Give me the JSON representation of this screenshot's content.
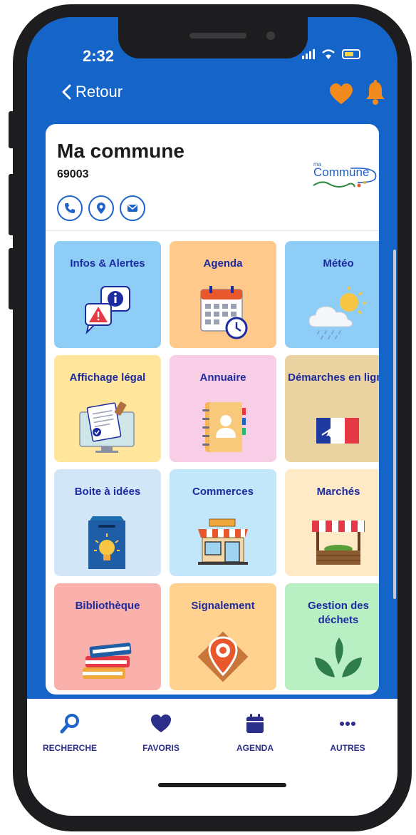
{
  "status": {
    "time": "2:32"
  },
  "header": {
    "back_label": "Retour"
  },
  "commune": {
    "name": "Ma commune",
    "postcode": "69003",
    "logo_small": "ma",
    "logo_main": "Commune"
  },
  "tiles": [
    {
      "label": "Infos & Alertes",
      "bg": "#8ecdf5",
      "icon": "alert-info-icon"
    },
    {
      "label": "Agenda",
      "bg": "#ffc98c",
      "icon": "calendar-clock-icon"
    },
    {
      "label": "Météo",
      "bg": "#8ecdf5",
      "icon": "weather-icon"
    },
    {
      "label": "Affichage légal",
      "bg": "#ffe69a",
      "icon": "legal-document-icon"
    },
    {
      "label": "Annuaire",
      "bg": "#f8cde6",
      "icon": "address-book-icon"
    },
    {
      "label": "Démarches en ligne",
      "bg": "#ead3a0",
      "icon": "marianne-icon"
    },
    {
      "label": "Boite à idées",
      "bg": "#d2e6f8",
      "icon": "idea-box-icon"
    },
    {
      "label": "Commerces",
      "bg": "#c2e6fa",
      "icon": "shop-icon"
    },
    {
      "label": "Marchés",
      "bg": "#ffeac7",
      "icon": "market-stall-icon"
    },
    {
      "label": "Bibliothèque",
      "bg": "#fab0ab",
      "icon": "books-icon"
    },
    {
      "label": "Signalement",
      "bg": "#ffd28f",
      "icon": "report-pin-icon"
    },
    {
      "label": "Gestion des déchets",
      "bg": "#b8f0c4",
      "icon": "leaves-icon"
    },
    {
      "label": "",
      "bg": "#c2f0e2"
    },
    {
      "label": "",
      "bg": "#c2e8fa"
    },
    {
      "label": "",
      "bg": "#c2d4fa"
    }
  ],
  "bottom_nav": [
    {
      "label": "RECHERCHE",
      "icon": "search-icon"
    },
    {
      "label": "FAVORIS",
      "icon": "heart-icon"
    },
    {
      "label": "AGENDA",
      "icon": "calendar-icon"
    },
    {
      "label": "AUTRES",
      "icon": "more-icon"
    }
  ],
  "colors": {
    "primary": "#1565c8",
    "accent": "#f28a1e",
    "nav_text": "#2b2f8a",
    "tile_text": "#1d2ba0"
  }
}
